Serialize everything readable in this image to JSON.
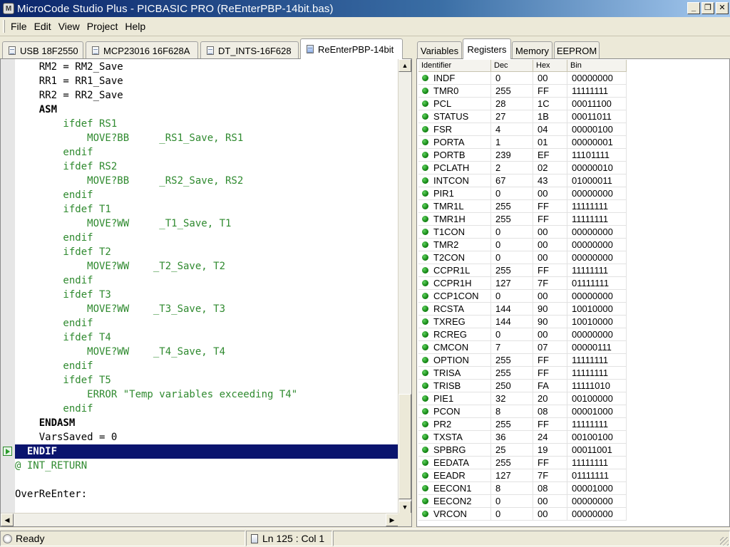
{
  "window": {
    "title": "MicroCode Studio Plus - PICBASIC PRO (ReEnterPBP-14bit.bas)",
    "app_icon": "microcode-app-icon",
    "buttons": {
      "minimize": "_",
      "maximize": "❐",
      "close": "✕"
    }
  },
  "menu": [
    "File",
    "Edit",
    "View",
    "Project",
    "Help"
  ],
  "editor_tabs": [
    {
      "label": "USB 18F2550",
      "icon": "document-icon",
      "active": false
    },
    {
      "label": "MCP23016 16F628A",
      "icon": "document-icon",
      "active": false
    },
    {
      "label": "DT_INTS-16F628",
      "icon": "document-icon",
      "active": false
    },
    {
      "label": "ReEnterPBP-14bit",
      "icon": "document-icon",
      "active": true
    }
  ],
  "code_lines": [
    {
      "text": "    RM2 = RM2_Save",
      "style": "black"
    },
    {
      "text": "    RR1 = RR1_Save",
      "style": "black"
    },
    {
      "text": "    RR2 = RR2_Save",
      "style": "black"
    },
    {
      "text": "    ASM",
      "style": "bold"
    },
    {
      "text": "        ifdef RS1",
      "style": "green"
    },
    {
      "text": "            MOVE?BB     _RS1_Save, RS1",
      "style": "green"
    },
    {
      "text": "        endif",
      "style": "green"
    },
    {
      "text": "        ifdef RS2",
      "style": "green"
    },
    {
      "text": "            MOVE?BB     _RS2_Save, RS2",
      "style": "green"
    },
    {
      "text": "        endif",
      "style": "green"
    },
    {
      "text": "        ifdef T1",
      "style": "green"
    },
    {
      "text": "            MOVE?WW     _T1_Save, T1",
      "style": "green"
    },
    {
      "text": "        endif",
      "style": "green"
    },
    {
      "text": "        ifdef T2",
      "style": "green"
    },
    {
      "text": "            MOVE?WW    _T2_Save, T2",
      "style": "green"
    },
    {
      "text": "        endif",
      "style": "green"
    },
    {
      "text": "        ifdef T3",
      "style": "green"
    },
    {
      "text": "            MOVE?WW    _T3_Save, T3",
      "style": "green"
    },
    {
      "text": "        endif",
      "style": "green"
    },
    {
      "text": "        ifdef T4",
      "style": "green"
    },
    {
      "text": "            MOVE?WW    _T4_Save, T4",
      "style": "green"
    },
    {
      "text": "        endif",
      "style": "green"
    },
    {
      "text": "        ifdef T5",
      "style": "green"
    },
    {
      "text": "            ERROR \"Temp variables exceeding T4\"",
      "style": "green"
    },
    {
      "text": "        endif",
      "style": "green"
    },
    {
      "text": "    ENDASM",
      "style": "bold"
    },
    {
      "text": "    VarsSaved = 0",
      "style": "black"
    },
    {
      "text": "  ENDIF",
      "style": "highlight",
      "exec_marker": true
    },
    {
      "text": "@ INT_RETURN",
      "style": "green"
    },
    {
      "text": "",
      "style": "black"
    },
    {
      "text": "OverReEnter:",
      "style": "black"
    }
  ],
  "panel_tabs": [
    {
      "label": "Variables",
      "active": false
    },
    {
      "label": "Registers",
      "active": true
    },
    {
      "label": "Memory",
      "active": false
    },
    {
      "label": "EEPROM",
      "active": false
    }
  ],
  "register_columns": [
    "Identifier",
    "Dec",
    "Hex",
    "Bin"
  ],
  "registers": [
    [
      "INDF",
      "0",
      "00",
      "00000000"
    ],
    [
      "TMR0",
      "255",
      "FF",
      "11111111"
    ],
    [
      "PCL",
      "28",
      "1C",
      "00011100"
    ],
    [
      "STATUS",
      "27",
      "1B",
      "00011011"
    ],
    [
      "FSR",
      "4",
      "04",
      "00000100"
    ],
    [
      "PORTA",
      "1",
      "01",
      "00000001"
    ],
    [
      "PORTB",
      "239",
      "EF",
      "11101111"
    ],
    [
      "PCLATH",
      "2",
      "02",
      "00000010"
    ],
    [
      "INTCON",
      "67",
      "43",
      "01000011"
    ],
    [
      "PIR1",
      "0",
      "00",
      "00000000"
    ],
    [
      "TMR1L",
      "255",
      "FF",
      "11111111"
    ],
    [
      "TMR1H",
      "255",
      "FF",
      "11111111"
    ],
    [
      "T1CON",
      "0",
      "00",
      "00000000"
    ],
    [
      "TMR2",
      "0",
      "00",
      "00000000"
    ],
    [
      "T2CON",
      "0",
      "00",
      "00000000"
    ],
    [
      "CCPR1L",
      "255",
      "FF",
      "11111111"
    ],
    [
      "CCPR1H",
      "127",
      "7F",
      "01111111"
    ],
    [
      "CCP1CON",
      "0",
      "00",
      "00000000"
    ],
    [
      "RCSTA",
      "144",
      "90",
      "10010000"
    ],
    [
      "TXREG",
      "144",
      "90",
      "10010000"
    ],
    [
      "RCREG",
      "0",
      "00",
      "00000000"
    ],
    [
      "CMCON",
      "7",
      "07",
      "00000111"
    ],
    [
      "OPTION",
      "255",
      "FF",
      "11111111"
    ],
    [
      "TRISA",
      "255",
      "FF",
      "11111111"
    ],
    [
      "TRISB",
      "250",
      "FA",
      "11111010"
    ],
    [
      "PIE1",
      "32",
      "20",
      "00100000"
    ],
    [
      "PCON",
      "8",
      "08",
      "00001000"
    ],
    [
      "PR2",
      "255",
      "FF",
      "11111111"
    ],
    [
      "TXSTA",
      "36",
      "24",
      "00100100"
    ],
    [
      "SPBRG",
      "25",
      "19",
      "00011001"
    ],
    [
      "EEDATA",
      "255",
      "FF",
      "11111111"
    ],
    [
      "EEADR",
      "127",
      "7F",
      "01111111"
    ],
    [
      "EECON1",
      "8",
      "08",
      "00001000"
    ],
    [
      "EECON2",
      "0",
      "00",
      "00000000"
    ],
    [
      "VRCON",
      "0",
      "00",
      "00000000"
    ]
  ],
  "status": {
    "ready": "Ready",
    "position": "Ln 125 : Col 1"
  },
  "colors": {
    "code_green": "#2f8a2f",
    "highlight_bg": "#0a146e",
    "led_green": "#0a7a0a"
  }
}
